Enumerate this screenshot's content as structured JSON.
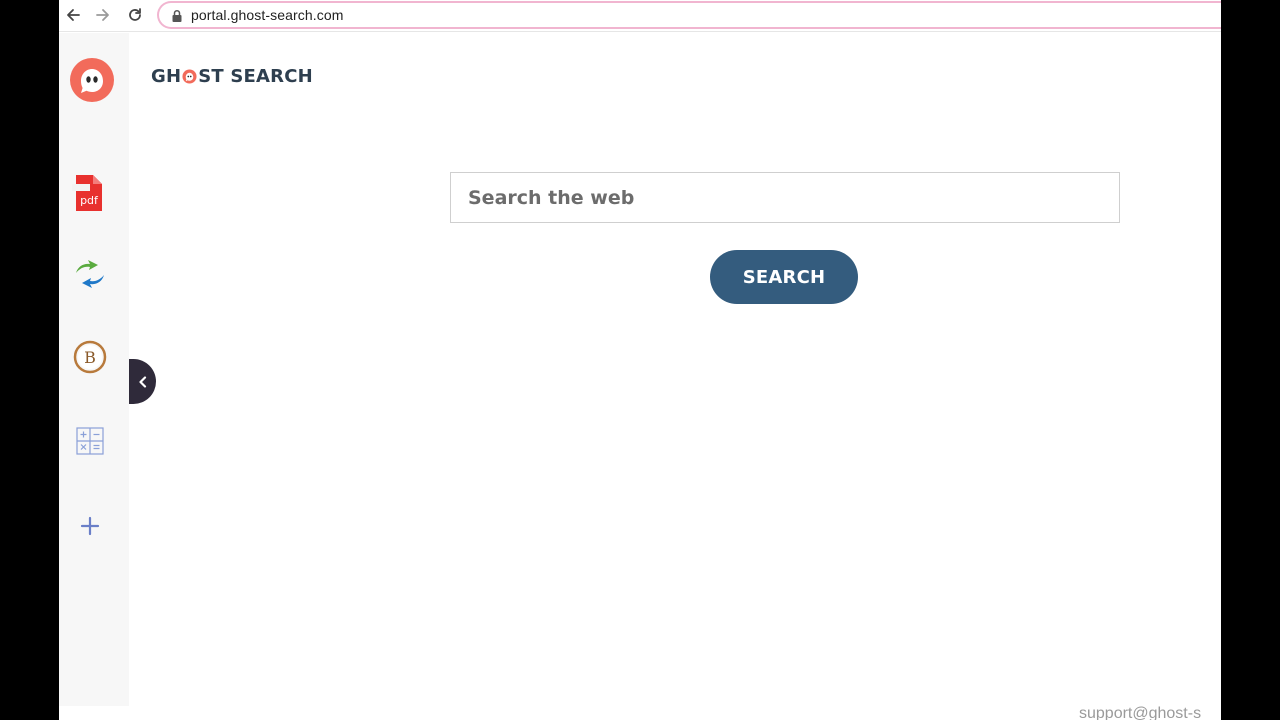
{
  "browser": {
    "url": "portal.ghost-search.com"
  },
  "logo": {
    "part1": "GH",
    "part2": "ST SEARCH"
  },
  "sidebar": {
    "items": [
      {
        "name": "ghost-app",
        "icon": "ghost-chat-icon"
      },
      {
        "name": "pdf",
        "icon": "pdf-icon",
        "label": "pdf"
      },
      {
        "name": "converter",
        "icon": "converter-arrows-icon"
      },
      {
        "name": "crypto",
        "icon": "bitcoin-icon",
        "label": "B"
      },
      {
        "name": "calculator",
        "icon": "calculator-icon"
      },
      {
        "name": "add",
        "icon": "plus-icon"
      }
    ]
  },
  "search": {
    "placeholder": "Search the web",
    "button_label": "SEARCH"
  },
  "footer": {
    "support_text": "support@ghost-s"
  },
  "colors": {
    "accent_button": "#345c7e",
    "logo_text": "#2e3f4f",
    "ghost_red": "#f26b5b",
    "omnibox_border": "#f1b5d0",
    "sidebar_bg": "#f7f7f7"
  }
}
